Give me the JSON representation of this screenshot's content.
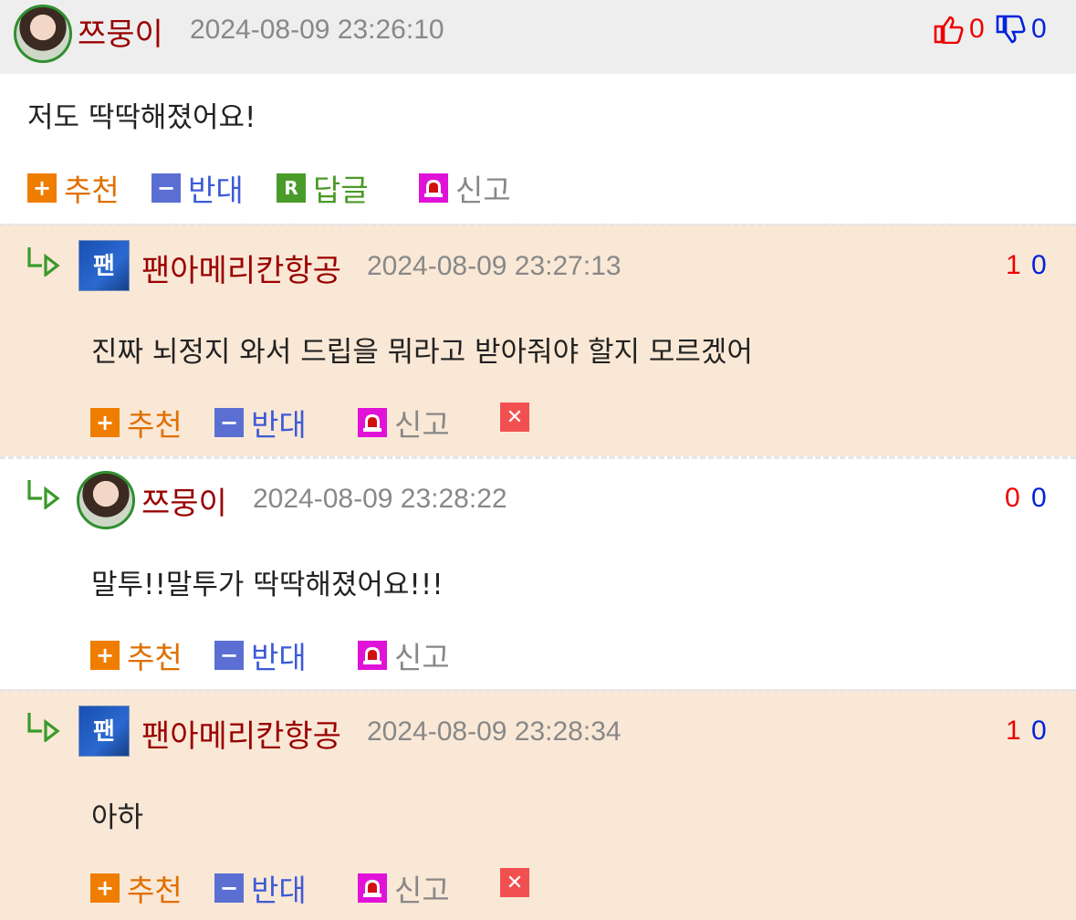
{
  "labels": {
    "recommend": "추천",
    "oppose": "반대",
    "reply": "답글",
    "report": "신고"
  },
  "comments": [
    {
      "author": "쯔뭉이",
      "datetime": "2024-08-09 23:26:10",
      "text": "저도 딱딱해졌어요!",
      "up": "0",
      "down": "0"
    },
    {
      "author": "팬아메리칸항공",
      "datetime": "2024-08-09 23:27:13",
      "text": "진짜 뇌정지 와서 드립을 뭐라고 받아줘야 할지 모르겠어",
      "up": "1",
      "down": "0",
      "avatar_text": "팬"
    },
    {
      "author": "쯔뭉이",
      "datetime": "2024-08-09 23:28:22",
      "text": "말투!!말투가 딱딱해졌어요!!!",
      "up": "0",
      "down": "0"
    },
    {
      "author": "팬아메리칸항공",
      "datetime": "2024-08-09 23:28:34",
      "text": "아하",
      "up": "1",
      "down": "0",
      "avatar_text": "팬"
    }
  ],
  "colors": {
    "author": "#990000",
    "upvote": "#ee0000",
    "downvote": "#0022dd",
    "reply_background": "#fae8d6"
  }
}
